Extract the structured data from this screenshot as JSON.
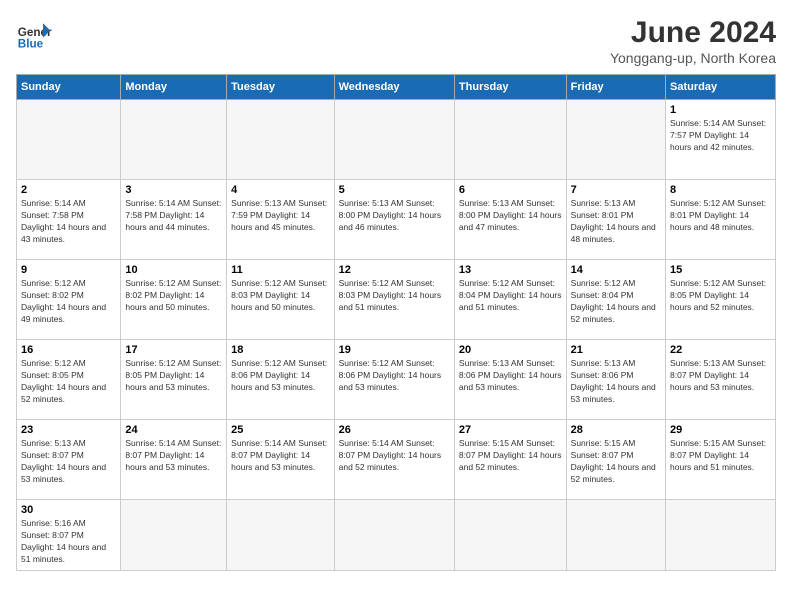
{
  "header": {
    "logo_text_normal": "General",
    "logo_text_colored": "Blue",
    "month_title": "June 2024",
    "subtitle": "Yonggang-up, North Korea"
  },
  "weekdays": [
    "Sunday",
    "Monday",
    "Tuesday",
    "Wednesday",
    "Thursday",
    "Friday",
    "Saturday"
  ],
  "weeks": [
    [
      {
        "day": "",
        "info": ""
      },
      {
        "day": "",
        "info": ""
      },
      {
        "day": "",
        "info": ""
      },
      {
        "day": "",
        "info": ""
      },
      {
        "day": "",
        "info": ""
      },
      {
        "day": "",
        "info": ""
      },
      {
        "day": "1",
        "info": "Sunrise: 5:14 AM\nSunset: 7:57 PM\nDaylight: 14 hours\nand 42 minutes."
      }
    ],
    [
      {
        "day": "2",
        "info": "Sunrise: 5:14 AM\nSunset: 7:58 PM\nDaylight: 14 hours\nand 43 minutes."
      },
      {
        "day": "3",
        "info": "Sunrise: 5:14 AM\nSunset: 7:58 PM\nDaylight: 14 hours\nand 44 minutes."
      },
      {
        "day": "4",
        "info": "Sunrise: 5:13 AM\nSunset: 7:59 PM\nDaylight: 14 hours\nand 45 minutes."
      },
      {
        "day": "5",
        "info": "Sunrise: 5:13 AM\nSunset: 8:00 PM\nDaylight: 14 hours\nand 46 minutes."
      },
      {
        "day": "6",
        "info": "Sunrise: 5:13 AM\nSunset: 8:00 PM\nDaylight: 14 hours\nand 47 minutes."
      },
      {
        "day": "7",
        "info": "Sunrise: 5:13 AM\nSunset: 8:01 PM\nDaylight: 14 hours\nand 48 minutes."
      },
      {
        "day": "8",
        "info": "Sunrise: 5:12 AM\nSunset: 8:01 PM\nDaylight: 14 hours\nand 48 minutes."
      }
    ],
    [
      {
        "day": "9",
        "info": "Sunrise: 5:12 AM\nSunset: 8:02 PM\nDaylight: 14 hours\nand 49 minutes."
      },
      {
        "day": "10",
        "info": "Sunrise: 5:12 AM\nSunset: 8:02 PM\nDaylight: 14 hours\nand 50 minutes."
      },
      {
        "day": "11",
        "info": "Sunrise: 5:12 AM\nSunset: 8:03 PM\nDaylight: 14 hours\nand 50 minutes."
      },
      {
        "day": "12",
        "info": "Sunrise: 5:12 AM\nSunset: 8:03 PM\nDaylight: 14 hours\nand 51 minutes."
      },
      {
        "day": "13",
        "info": "Sunrise: 5:12 AM\nSunset: 8:04 PM\nDaylight: 14 hours\nand 51 minutes."
      },
      {
        "day": "14",
        "info": "Sunrise: 5:12 AM\nSunset: 8:04 PM\nDaylight: 14 hours\nand 52 minutes."
      },
      {
        "day": "15",
        "info": "Sunrise: 5:12 AM\nSunset: 8:05 PM\nDaylight: 14 hours\nand 52 minutes."
      }
    ],
    [
      {
        "day": "16",
        "info": "Sunrise: 5:12 AM\nSunset: 8:05 PM\nDaylight: 14 hours\nand 52 minutes."
      },
      {
        "day": "17",
        "info": "Sunrise: 5:12 AM\nSunset: 8:05 PM\nDaylight: 14 hours\nand 53 minutes."
      },
      {
        "day": "18",
        "info": "Sunrise: 5:12 AM\nSunset: 8:06 PM\nDaylight: 14 hours\nand 53 minutes."
      },
      {
        "day": "19",
        "info": "Sunrise: 5:12 AM\nSunset: 8:06 PM\nDaylight: 14 hours\nand 53 minutes."
      },
      {
        "day": "20",
        "info": "Sunrise: 5:13 AM\nSunset: 8:06 PM\nDaylight: 14 hours\nand 53 minutes."
      },
      {
        "day": "21",
        "info": "Sunrise: 5:13 AM\nSunset: 8:06 PM\nDaylight: 14 hours\nand 53 minutes."
      },
      {
        "day": "22",
        "info": "Sunrise: 5:13 AM\nSunset: 8:07 PM\nDaylight: 14 hours\nand 53 minutes."
      }
    ],
    [
      {
        "day": "23",
        "info": "Sunrise: 5:13 AM\nSunset: 8:07 PM\nDaylight: 14 hours\nand 53 minutes."
      },
      {
        "day": "24",
        "info": "Sunrise: 5:14 AM\nSunset: 8:07 PM\nDaylight: 14 hours\nand 53 minutes."
      },
      {
        "day": "25",
        "info": "Sunrise: 5:14 AM\nSunset: 8:07 PM\nDaylight: 14 hours\nand 53 minutes."
      },
      {
        "day": "26",
        "info": "Sunrise: 5:14 AM\nSunset: 8:07 PM\nDaylight: 14 hours\nand 52 minutes."
      },
      {
        "day": "27",
        "info": "Sunrise: 5:15 AM\nSunset: 8:07 PM\nDaylight: 14 hours\nand 52 minutes."
      },
      {
        "day": "28",
        "info": "Sunrise: 5:15 AM\nSunset: 8:07 PM\nDaylight: 14 hours\nand 52 minutes."
      },
      {
        "day": "29",
        "info": "Sunrise: 5:15 AM\nSunset: 8:07 PM\nDaylight: 14 hours\nand 51 minutes."
      }
    ],
    [
      {
        "day": "30",
        "info": "Sunrise: 5:16 AM\nSunset: 8:07 PM\nDaylight: 14 hours\nand 51 minutes."
      },
      {
        "day": "",
        "info": ""
      },
      {
        "day": "",
        "info": ""
      },
      {
        "day": "",
        "info": ""
      },
      {
        "day": "",
        "info": ""
      },
      {
        "day": "",
        "info": ""
      },
      {
        "day": "",
        "info": ""
      }
    ]
  ]
}
